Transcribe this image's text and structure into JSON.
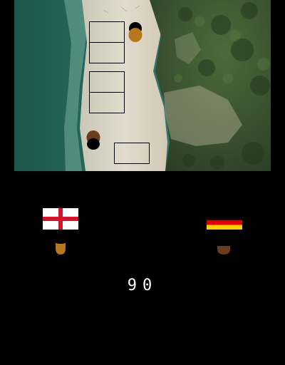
{
  "colors": {
    "background": "#000000",
    "sea_deep": "#1f5a52",
    "sea_shallow": "#5a9c8e",
    "sand": "#d9d1c2",
    "vegetation": "#3e5530",
    "token_player1": "#b7771e",
    "token_player2": "#6b3b1e",
    "score_text": "#ffffff"
  },
  "board": {
    "slots": [
      {
        "id": "slot-1"
      },
      {
        "id": "slot-2"
      },
      {
        "id": "slot-3"
      },
      {
        "id": "slot-4"
      },
      {
        "id": "slot-5"
      }
    ]
  },
  "players": [
    {
      "id": "player-1",
      "flag": "england-flag-icon"
    },
    {
      "id": "player-2",
      "flag": "germany-flag-icon"
    }
  ],
  "score": {
    "player1": "9",
    "player2": "0"
  }
}
